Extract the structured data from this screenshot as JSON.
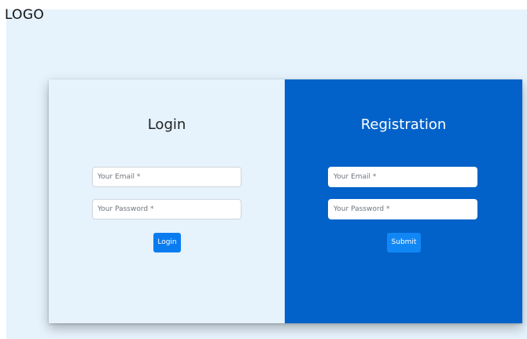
{
  "header": {
    "logo_text": "LOGO"
  },
  "login": {
    "title": "Login",
    "email_placeholder": "Your Email *",
    "password_placeholder": "Your Password *",
    "button_label": "Login"
  },
  "registration": {
    "title": "Registration",
    "email_placeholder": "Your Email *",
    "password_placeholder": "Your Password *",
    "button_label": "Submit"
  },
  "colors": {
    "page_background": "#e6f2fc",
    "registration_panel": "#0262c9",
    "button": "#0b7cf0"
  }
}
